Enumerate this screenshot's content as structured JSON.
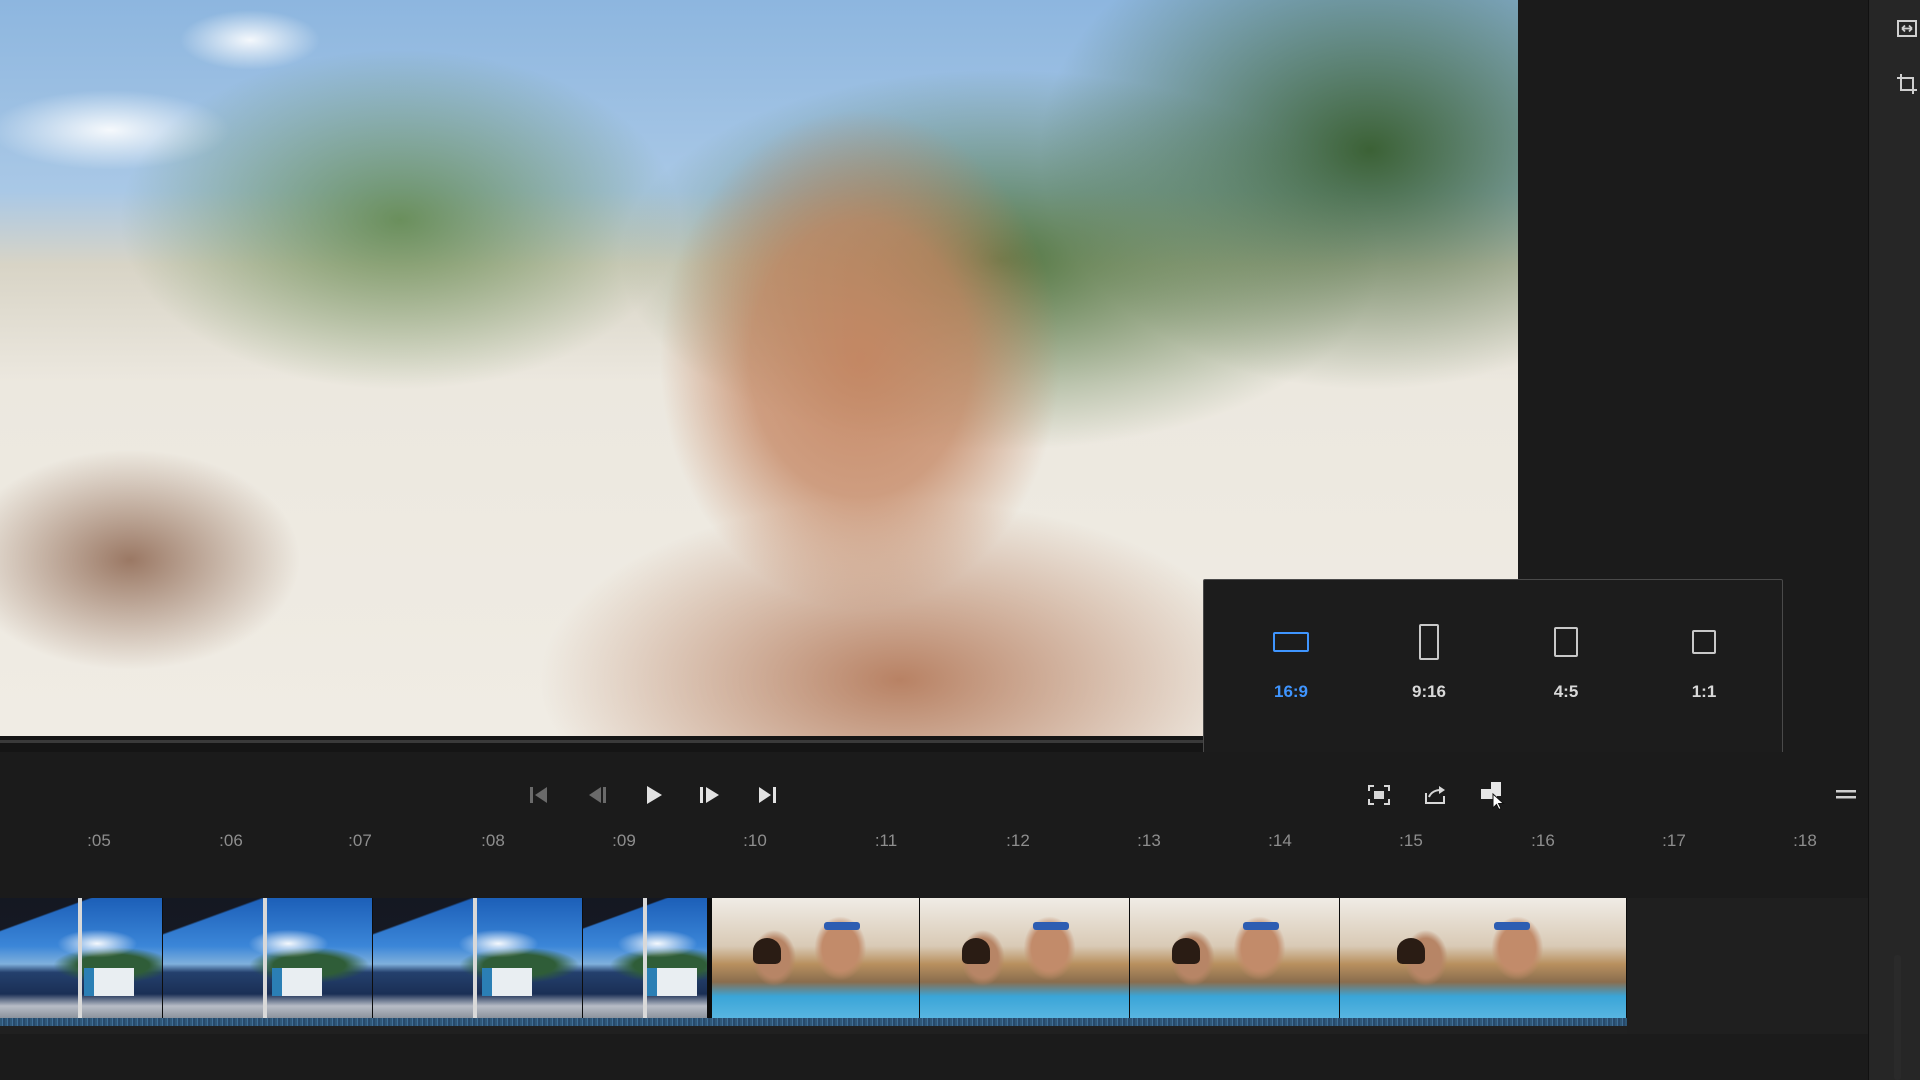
{
  "aspect_ratio_menu": {
    "options": [
      {
        "label": "16:9",
        "selected": true
      },
      {
        "label": "9:16",
        "selected": false
      },
      {
        "label": "4:5",
        "selected": false
      },
      {
        "label": "1:1",
        "selected": false
      }
    ]
  },
  "transport": {
    "buttons": [
      "go-to-in-icon",
      "step-back-icon",
      "play-icon",
      "step-forward-icon",
      "go-to-end-icon"
    ],
    "tools": [
      "fit-frame-icon",
      "export-frame-icon",
      "aspect-ratio-icon",
      "menu-icon"
    ]
  },
  "timeline": {
    "ruler_labels": [
      ":05",
      ":06",
      ":07",
      ":08",
      ":09",
      ":10",
      ":11",
      ":12",
      ":13",
      ":14",
      ":15",
      ":16",
      ":17",
      ":18"
    ],
    "clips": [
      {
        "name": "boat-clip",
        "frames": 4
      },
      {
        "name": "selfie-clip",
        "frames": 4
      }
    ]
  },
  "side_tools": [
    "fit-to-width-icon",
    "crop-icon"
  ],
  "colors": {
    "accent": "#3f95ff",
    "panel": "#1b1b1b",
    "popover_border": "#4a4a4a"
  }
}
